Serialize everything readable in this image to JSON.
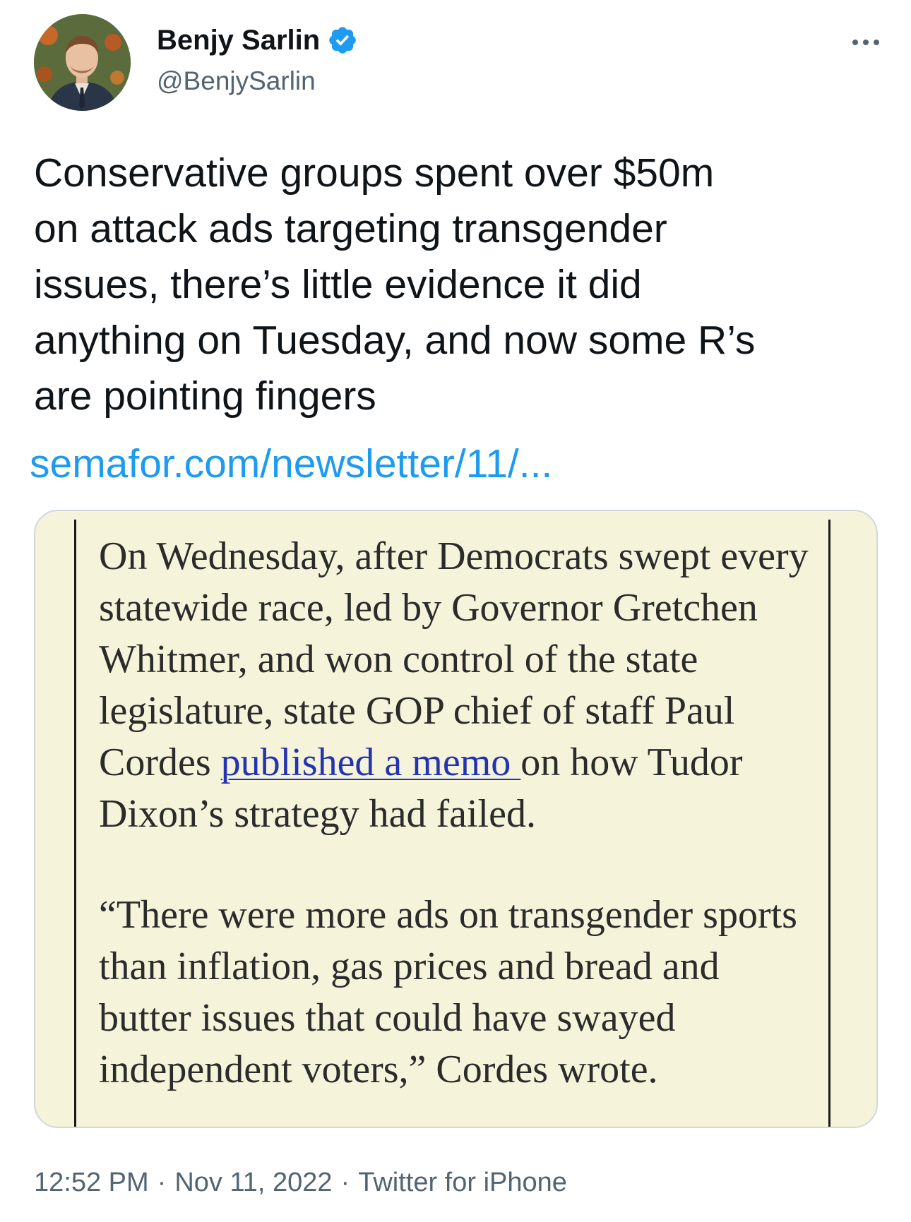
{
  "author": {
    "display_name": "Benjy Sarlin",
    "handle": "@BenjySarlin",
    "verified": true,
    "avatar_icon": "profile-photo"
  },
  "tweet": {
    "text": "Conservative groups spent over $50m\non attack ads targeting transgender\nissues, there’s little evidence it did\nanything on Tuesday, and now some R’s\nare pointing fingers",
    "link": "semafor.com/newsletter/11/..."
  },
  "media": {
    "para1_before_link": "On Wednesday, after Democrats swept every statewide race, led by Governor Gretchen Whitmer, and won control of the state legislature, state GOP chief of staff Paul Cordes ",
    "para1_link": "published a memo ",
    "para1_after_link": "on how Tudor Dixon’s strategy had failed.",
    "para2": "“There were more ads on transgender sports than inflation, gas prices and bread and butter issues that could have swayed independent voters,” Cordes wrote."
  },
  "meta": {
    "time": "12:52 PM",
    "date": "Nov 11, 2022",
    "source": "Twitter for iPhone",
    "separator": "·"
  },
  "colors": {
    "link": "#1d9bf0",
    "verified": "#1d9bf0",
    "secondary_text": "#536471",
    "media_bg": "#f5f3d9"
  }
}
